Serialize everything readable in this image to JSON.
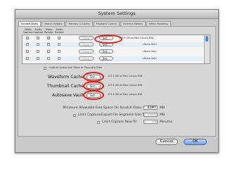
{
  "window": {
    "title": "System Settings"
  },
  "tabs": [
    "Scratch Disks",
    "Search Folders",
    "Memory & Cache",
    "Playback Control",
    "External Editors",
    "Effect Handling"
  ],
  "columns": [
    "Video Capture",
    "Audio Capture",
    "Video Render",
    "Audio Render"
  ],
  "scratch_rows": [
    {
      "clear": "Clear",
      "set": "Set...",
      "path": "127.4 GB on Kaci LaLuzz Edit",
      "checks": [
        true,
        true,
        true,
        true
      ]
    },
    {
      "clear": "Clear",
      "set": "Set...",
      "path": "<None Set>",
      "checks": [
        false,
        false,
        false,
        false
      ]
    },
    {
      "clear": "Clear",
      "set": "Set...",
      "path": "<None Set>",
      "checks": [
        false,
        false,
        false,
        false
      ]
    },
    {
      "clear": "Clear",
      "set": "Set...",
      "path": "<None Set>",
      "checks": [
        false,
        false,
        false,
        false
      ]
    }
  ],
  "separate_files_label": "Capture Audio and Video to Separate Files",
  "cache_rows": [
    {
      "label": "Waveform Cache",
      "set": "Set...",
      "path": "127.4 GB on Kaci LaLuzz Edit"
    },
    {
      "label": "Thumbnail Cache",
      "set": "Set...",
      "path": "127.4 GB on Kaci LaLuzz Edit"
    },
    {
      "label": "Autosave Vault",
      "set": "Set...",
      "path": "127.4 GB on Kaci LaLuzz Edit"
    }
  ],
  "min_free": {
    "label": "Minimum Allowable Free Space On Scratch Disks:",
    "value": "2047",
    "unit": "MB"
  },
  "limit_segment": {
    "label": "Limit Capture/Export File Segment Size To:",
    "value": "2000",
    "unit": "MB"
  },
  "limit_capture": {
    "label": "Limit Capture Now To:",
    "value": "30",
    "unit": "Minutes"
  },
  "buttons": {
    "cancel": "Cancel",
    "ok": "OK"
  },
  "colors": {
    "highlight": "#e0211c",
    "accent": "#4f86d8"
  }
}
